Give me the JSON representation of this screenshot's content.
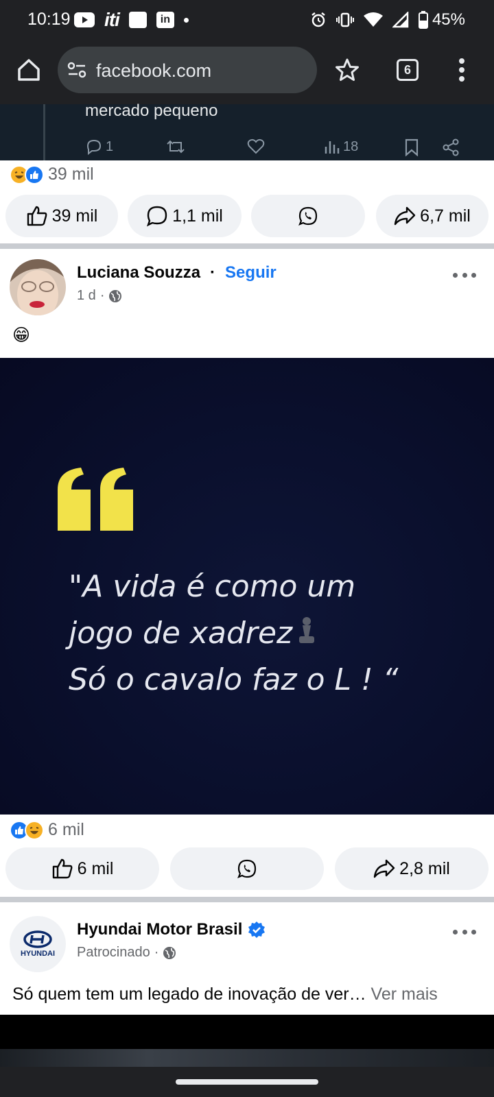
{
  "status_bar": {
    "time": "10:19",
    "iti_label": "iti",
    "linkedin_label": "in",
    "battery": "45%",
    "icons": [
      "youtube-icon",
      "iti-icon",
      "app-square-icon",
      "linkedin-icon",
      "notification-dot-icon",
      "alarm-icon",
      "vibrate-icon",
      "wifi-icon",
      "signal-icon",
      "battery-icon"
    ]
  },
  "browser": {
    "url": "facebook.com",
    "tab_count": "6"
  },
  "tweet_embed": {
    "text": "mercado pequeno",
    "replies": "1",
    "views": "18"
  },
  "post1": {
    "reaction_count": "39 mil",
    "like_count": "39 mil",
    "comment_count": "1,1 mil",
    "share_count": "6,7 mil"
  },
  "post2": {
    "author": "Luciana Souzza",
    "follow_label": "Seguir",
    "time": "1 d",
    "text": "😁",
    "quote_lines": [
      "\"A vida é como um",
      "jogo de xadrez",
      "Só o cavalo faz o L ! “"
    ],
    "reaction_count": "6 mil",
    "like_count": "6 mil",
    "share_count": "2,8 mil"
  },
  "post3": {
    "author": "Hyundai Motor Brasil",
    "logo_text": "HYUNDAI",
    "meta": "Patrocinado",
    "text": "Só quem tem um legado de inovação de ver…",
    "see_more": "Ver mais"
  },
  "colors": {
    "facebook_blue": "#1877f2",
    "chrome_dark": "#202124",
    "pill_bg": "#f0f2f5",
    "quote_yellow": "#f2e24a",
    "quote_bg": "#0a0f2c"
  }
}
